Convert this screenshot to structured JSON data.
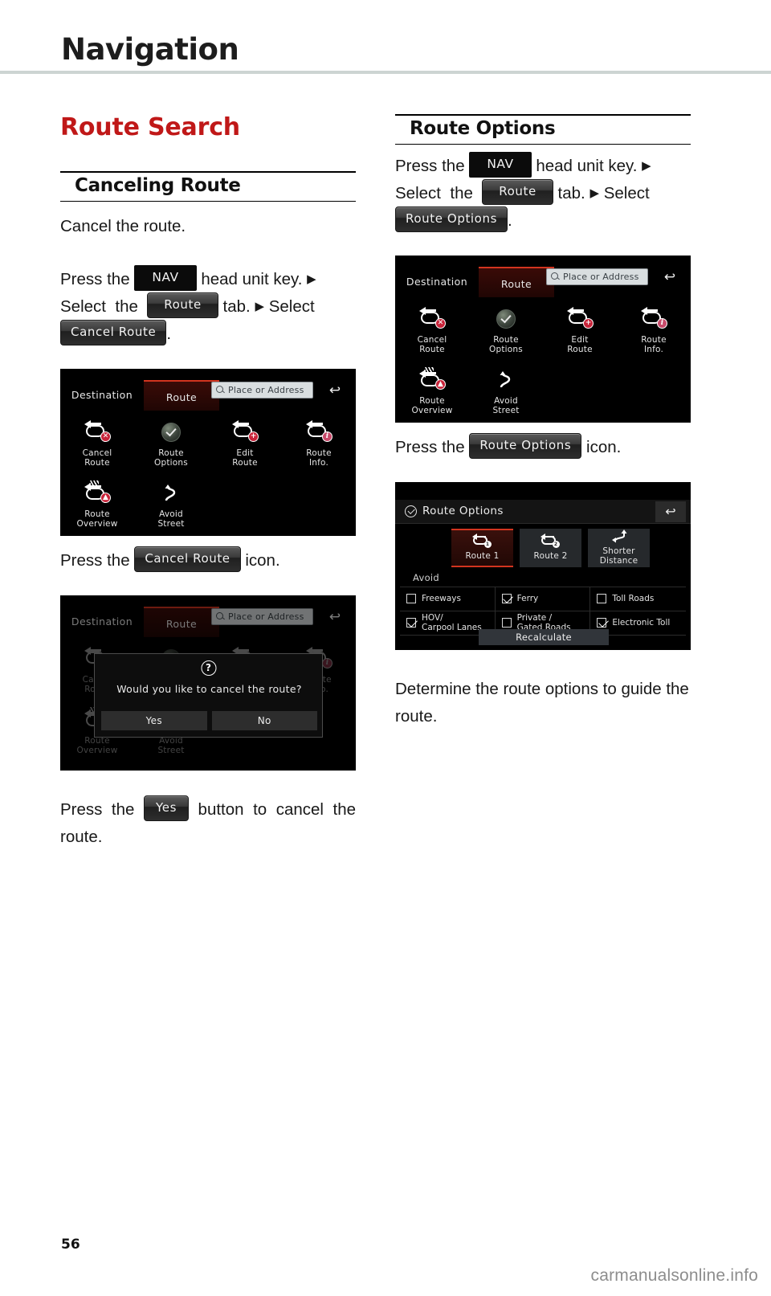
{
  "header": {
    "title": "Navigation"
  },
  "footer": {
    "page_number": "56",
    "watermark": "carmanualsonline.info"
  },
  "left_column": {
    "section_title": "Route Search",
    "subheading": "Canceling Route",
    "intro": "Cancel the route.",
    "steps": {
      "press_the": "Press the",
      "nav_key": "NAV",
      "head_unit_key": "head unit key.",
      "arrow": "▶",
      "select": "Select",
      "the": "the",
      "route_tab": "Route",
      "tab_word": "tab.",
      "select2": "Select",
      "cancel_route_chip": "Cancel Route",
      "period": "."
    },
    "caption_press_icon": {
      "pre": "Press the",
      "chip": "Cancel Route",
      "post": "icon."
    },
    "caption_press_yes": {
      "pre": "Press the",
      "chip": "Yes",
      "post": "button to cancel the route."
    }
  },
  "right_column": {
    "subheading": "Route Options",
    "steps": {
      "press_the": "Press the",
      "nav_key": "NAV",
      "head_unit_key": "head unit key.",
      "arrow": "▶",
      "select": "Select",
      "the": "the",
      "route_tab": "Route",
      "tab_word": "tab.",
      "select2": "Select",
      "route_options_chip": "Route Options",
      "period": "."
    },
    "caption_press_icon": {
      "pre": "Press the",
      "chip": "Route Options",
      "post": "icon."
    },
    "description": "Determine the route options to guide the route."
  },
  "head_unit_screen": {
    "tabs": {
      "destination": "Destination",
      "route": "Route"
    },
    "search_placeholder": "Place or Address",
    "back_icon": "↩",
    "menu_items": [
      {
        "label_line1": "Cancel",
        "label_line2": "Route",
        "icon": "cancel-route-icon"
      },
      {
        "label_line1": "Route",
        "label_line2": "Options",
        "icon": "route-options-icon"
      },
      {
        "label_line1": "Edit",
        "label_line2": "Route",
        "icon": "edit-route-icon"
      },
      {
        "label_line1": "Route",
        "label_line2": "Info.",
        "icon": "route-info-icon"
      },
      {
        "label_line1": "Route",
        "label_line2": "Overview",
        "icon": "route-overview-icon"
      },
      {
        "label_line1": "Avoid",
        "label_line2": "Street",
        "icon": "avoid-street-icon"
      }
    ]
  },
  "cancel_dialog": {
    "question_icon": "?",
    "message": "Would you like to cancel the route?",
    "yes": "Yes",
    "no": "No"
  },
  "route_options_screen": {
    "title": "Route Options",
    "back_icon": "↩",
    "route_tabs": [
      {
        "label_line1": "Route 1",
        "label_line2": "",
        "selected": true
      },
      {
        "label_line1": "Route 2",
        "label_line2": "",
        "selected": false
      },
      {
        "label_line1": "Shorter",
        "label_line2": "Distance",
        "selected": false
      }
    ],
    "avoid_label": "Avoid",
    "avoid_options": [
      {
        "label_line1": "Freeways",
        "label_line2": "",
        "checked": false
      },
      {
        "label_line1": "Ferry",
        "label_line2": "",
        "checked": true
      },
      {
        "label_line1": "Toll Roads",
        "label_line2": "",
        "checked": false
      },
      {
        "label_line1": "HOV/",
        "label_line2": "Carpool Lanes",
        "checked": true
      },
      {
        "label_line1": "Private /",
        "label_line2": "Gated Roads",
        "checked": false
      },
      {
        "label_line1": "Electronic Toll",
        "label_line2": "",
        "checked": true
      }
    ],
    "recalculate": "Recalculate"
  },
  "colors": {
    "accent_red": "#c01818",
    "ui_highlight_red": "#d2341f",
    "header_rule": "#cdd4d2",
    "watermark_gray": "#8d8d8d"
  }
}
